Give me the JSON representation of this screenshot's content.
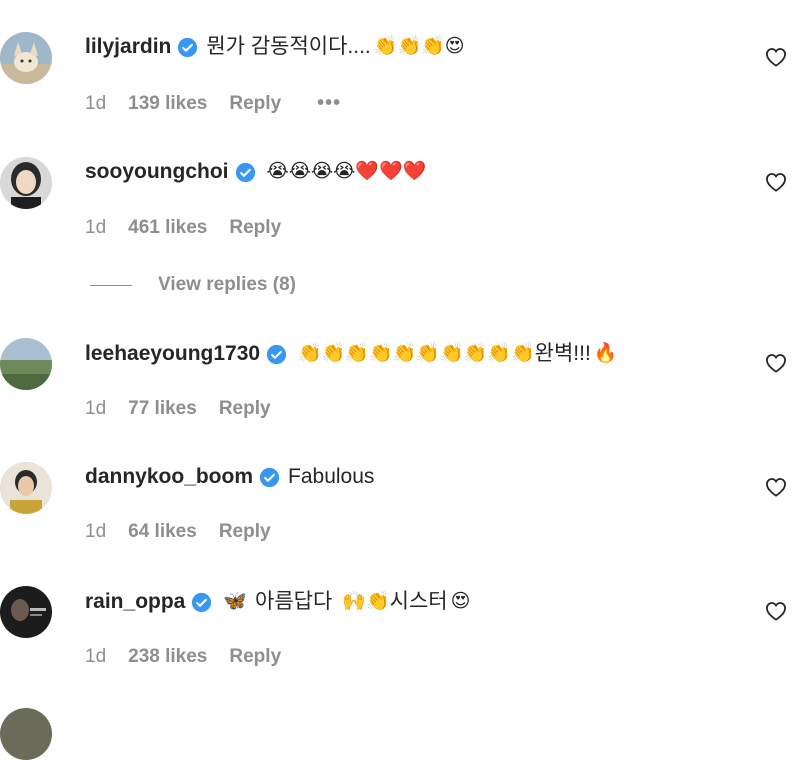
{
  "comments": [
    {
      "username": "lilyjardin",
      "text": "뭔가 감동적이다....",
      "emoji": "👏👏👏😍",
      "time": "1d",
      "likes": "139 likes",
      "reply": "Reply",
      "more": "•••"
    },
    {
      "username": "sooyoungchoi",
      "text": "",
      "emoji": "😭😭😭😭❤️❤️❤️",
      "time": "1d",
      "likes": "461 likes",
      "reply": "Reply",
      "view_replies": "View replies (8)"
    },
    {
      "username": "leehaeyoung1730",
      "text": "",
      "emoji": "👏👏👏👏👏👏👏👏👏👏",
      "text_after": "완벽!!!",
      "emoji_after": "🔥",
      "time": "1d",
      "likes": "77 likes",
      "reply": "Reply"
    },
    {
      "username": "dannykoo_boom",
      "text": "Fabulous",
      "emoji": "",
      "time": "1d",
      "likes": "64 likes",
      "reply": "Reply"
    },
    {
      "username": "rain_oppa",
      "text": "",
      "emoji": "🦋",
      "text_after": "아름답다",
      "emoji_after": "🙌👏",
      "text_after2": "시스터",
      "emoji_after2": "😍",
      "time": "1d",
      "likes": "238 likes",
      "reply": "Reply"
    }
  ],
  "colors": {
    "verified": "#3897f0",
    "muted": "#8e8e8e",
    "text": "#262626"
  }
}
